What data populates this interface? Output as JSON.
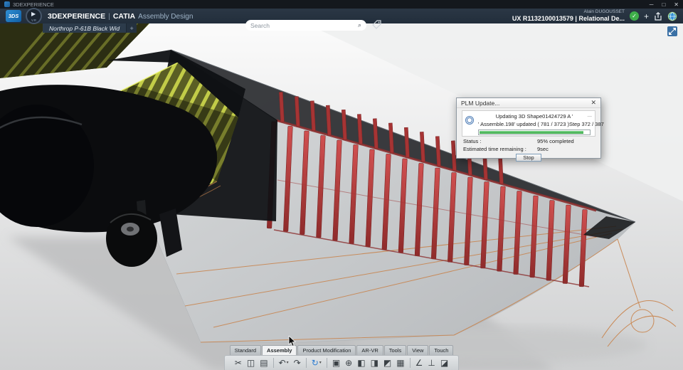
{
  "window": {
    "title": "3DEXPERIENCE",
    "minimize": "─",
    "maximize": "□",
    "close": "✕"
  },
  "header": {
    "logo_text": "3DS",
    "compass_sub": "V.R",
    "brand_main": "3DEXPERIENCE",
    "brand_sep": "|",
    "brand_app": "CATIA",
    "brand_role": "Assembly Design",
    "search_placeholder": "Search",
    "user_name": "Alain DUGOUSSET",
    "session": "UX R1132100013579 | Relational De...",
    "add_label": "+"
  },
  "doc_tab": {
    "label": "Northrop P-61B Black Wid",
    "add": "+"
  },
  "dialog": {
    "title": "PLM Update...",
    "more": "...",
    "line1": "Updating 3D Shape01424729 A '",
    "line2": "' Assemble.198' updated ( 781 / 3723 )",
    "step": "Step 372 / 387",
    "status_label": "Status :",
    "status_value": "95% completed",
    "eta_label": "Estimated time remaining :",
    "eta_value": "9sec",
    "stop_label": "Stop",
    "progress_percent": 95
  },
  "bottom_tabs": [
    {
      "label": "Standard"
    },
    {
      "label": "Assembly",
      "active": true
    },
    {
      "label": "Product Modification"
    },
    {
      "label": "AR-VR"
    },
    {
      "label": "Tools"
    },
    {
      "label": "View"
    },
    {
      "label": "Touch"
    }
  ],
  "toolbar": {
    "items": [
      {
        "name": "cut",
        "glyph": "✂"
      },
      {
        "name": "copy",
        "glyph": "◫"
      },
      {
        "name": "paste",
        "glyph": "▤"
      },
      {
        "name": "undo",
        "glyph": "↶",
        "caret": "▾"
      },
      {
        "name": "redo",
        "glyph": "↷"
      },
      {
        "name": "update",
        "glyph": "↻",
        "caret": "▾"
      },
      {
        "name": "insert-product",
        "glyph": "▣"
      },
      {
        "name": "axis-system",
        "glyph": "⊕"
      },
      {
        "name": "new-component",
        "glyph": "◧"
      },
      {
        "name": "existing-product",
        "glyph": "◨"
      },
      {
        "name": "snap",
        "glyph": "◩"
      },
      {
        "name": "assemble",
        "glyph": "▦"
      },
      {
        "name": "engineering-connection",
        "glyph": "∠"
      },
      {
        "name": "fix",
        "glyph": "⊥"
      },
      {
        "name": "section",
        "glyph": "◪"
      }
    ]
  },
  "colors": {
    "accent_blue": "#2e7dd1",
    "progress_green": "#3fae4a",
    "rib_red": "#b23a3a",
    "rib_yellow": "#c9d24b",
    "wire_orange": "#c8824a"
  }
}
